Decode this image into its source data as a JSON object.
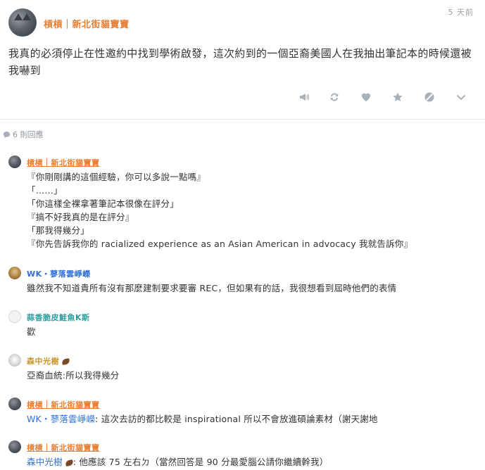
{
  "post": {
    "author": "槓槓｜新北街貓寶寶",
    "time": "5 天前",
    "body": "我真的必須停止在性邀約中找到學術啟發，這次約到的一個亞裔美國人在我抽出筆記本的時候還被我嚇到"
  },
  "actions": [
    {
      "name": "megaphone-icon"
    },
    {
      "name": "repost-icon"
    },
    {
      "name": "heart-icon"
    },
    {
      "name": "star-icon"
    },
    {
      "name": "block-icon"
    },
    {
      "name": "chevron-down-icon"
    }
  ],
  "reply_count": "6 則回應",
  "comments": [
    {
      "author": "槓槓｜新北街貓寶寶",
      "lines": [
        "『你剛剛講的這個經驗，你可以多說一點嗎』",
        "「……」",
        "「你這樣全裸拿著筆記本很像在評分」",
        "『搞不好我真的是在評分』",
        "「那我得幾分」",
        "『你先告訴我你的 racialized experience as an Asian American in advocacy 我就告訴你』"
      ]
    },
    {
      "author": "WK・蓼落雲崢嶸",
      "lines": [
        "雖然我不知道貴所有沒有那麼建制要求要審 REC，但如果有的話，我很想看到屆時他們的表情"
      ]
    },
    {
      "author": "蒜香脆皮鮭魚K斯",
      "lines": [
        "歡"
      ]
    },
    {
      "author": "森中光樹",
      "lines": [
        "亞裔血統:所以我得幾分"
      ]
    },
    {
      "author": "槓槓｜新北街貓寶寶",
      "mention": "WK・蓼落雲崢嶸",
      "text": ": 這次去訪的都比較是 inspirational 所以不會放進碩論素材（謝天謝地"
    },
    {
      "author": "槓槓｜新北街貓寶寶",
      "mention": "森中光樹",
      "text": ": 他應該 75 左右ㄉ（當然回答是 90 分最愛腦公請你繼續幹我）"
    }
  ]
}
